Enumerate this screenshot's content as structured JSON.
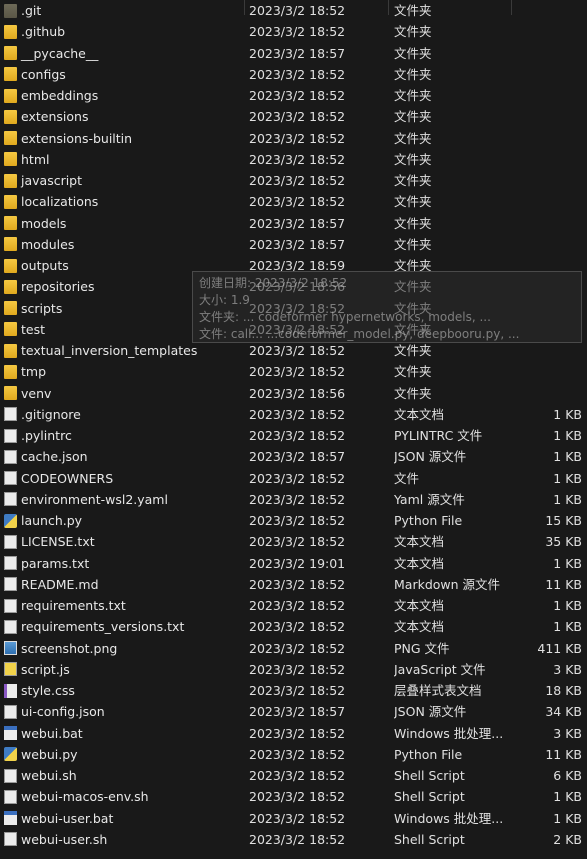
{
  "rows": [
    {
      "name": ".git",
      "date": "2023/3/2 18:52",
      "type": "文件夹",
      "size": "",
      "icon": "folder-icon-hidden"
    },
    {
      "name": ".github",
      "date": "2023/3/2 18:52",
      "type": "文件夹",
      "size": "",
      "icon": "folder-icon"
    },
    {
      "name": "__pycache__",
      "date": "2023/3/2 18:57",
      "type": "文件夹",
      "size": "",
      "icon": "folder-icon"
    },
    {
      "name": "configs",
      "date": "2023/3/2 18:52",
      "type": "文件夹",
      "size": "",
      "icon": "folder-icon"
    },
    {
      "name": "embeddings",
      "date": "2023/3/2 18:52",
      "type": "文件夹",
      "size": "",
      "icon": "folder-icon"
    },
    {
      "name": "extensions",
      "date": "2023/3/2 18:52",
      "type": "文件夹",
      "size": "",
      "icon": "folder-icon"
    },
    {
      "name": "extensions-builtin",
      "date": "2023/3/2 18:52",
      "type": "文件夹",
      "size": "",
      "icon": "folder-icon"
    },
    {
      "name": "html",
      "date": "2023/3/2 18:52",
      "type": "文件夹",
      "size": "",
      "icon": "folder-icon"
    },
    {
      "name": "javascript",
      "date": "2023/3/2 18:52",
      "type": "文件夹",
      "size": "",
      "icon": "folder-icon"
    },
    {
      "name": "localizations",
      "date": "2023/3/2 18:52",
      "type": "文件夹",
      "size": "",
      "icon": "folder-icon"
    },
    {
      "name": "models",
      "date": "2023/3/2 18:57",
      "type": "文件夹",
      "size": "",
      "icon": "folder-icon"
    },
    {
      "name": "modules",
      "date": "2023/3/2 18:57",
      "type": "文件夹",
      "size": "",
      "icon": "folder-icon"
    },
    {
      "name": "outputs",
      "date": "2023/3/2 18:59",
      "type": "文件夹",
      "size": "",
      "icon": "folder-icon"
    },
    {
      "name": "repositories",
      "date": "2023/3/2 18:56",
      "type": "文件夹",
      "size": "",
      "icon": "folder-icon"
    },
    {
      "name": "scripts",
      "date": "2023/3/2 18:52",
      "type": "文件夹",
      "size": "",
      "icon": "folder-icon"
    },
    {
      "name": "test",
      "date": "2023/3/2 18:52",
      "type": "文件夹",
      "size": "",
      "icon": "folder-icon"
    },
    {
      "name": "textual_inversion_templates",
      "date": "2023/3/2 18:52",
      "type": "文件夹",
      "size": "",
      "icon": "folder-icon"
    },
    {
      "name": "tmp",
      "date": "2023/3/2 18:52",
      "type": "文件夹",
      "size": "",
      "icon": "folder-icon"
    },
    {
      "name": "venv",
      "date": "2023/3/2 18:56",
      "type": "文件夹",
      "size": "",
      "icon": "folder-icon"
    },
    {
      "name": ".gitignore",
      "date": "2023/3/2 18:52",
      "type": "文本文档",
      "size": "1 KB",
      "icon": "file-icon"
    },
    {
      "name": ".pylintrc",
      "date": "2023/3/2 18:52",
      "type": "PYLINTRC 文件",
      "size": "1 KB",
      "icon": "file-icon"
    },
    {
      "name": "cache.json",
      "date": "2023/3/2 18:57",
      "type": "JSON 源文件",
      "size": "1 KB",
      "icon": "json-icon"
    },
    {
      "name": "CODEOWNERS",
      "date": "2023/3/2 18:52",
      "type": "文件",
      "size": "1 KB",
      "icon": "file-icon"
    },
    {
      "name": "environment-wsl2.yaml",
      "date": "2023/3/2 18:52",
      "type": "Yaml 源文件",
      "size": "1 KB",
      "icon": "yaml-icon"
    },
    {
      "name": "launch.py",
      "date": "2023/3/2 18:52",
      "type": "Python File",
      "size": "15 KB",
      "icon": "python-icon"
    },
    {
      "name": "LICENSE.txt",
      "date": "2023/3/2 18:52",
      "type": "文本文档",
      "size": "35 KB",
      "icon": "file-icon"
    },
    {
      "name": "params.txt",
      "date": "2023/3/2 19:01",
      "type": "文本文档",
      "size": "1 KB",
      "icon": "file-icon"
    },
    {
      "name": "README.md",
      "date": "2023/3/2 18:52",
      "type": "Markdown 源文件",
      "size": "11 KB",
      "icon": "markdown-icon"
    },
    {
      "name": "requirements.txt",
      "date": "2023/3/2 18:52",
      "type": "文本文档",
      "size": "1 KB",
      "icon": "file-icon"
    },
    {
      "name": "requirements_versions.txt",
      "date": "2023/3/2 18:52",
      "type": "文本文档",
      "size": "1 KB",
      "icon": "file-icon"
    },
    {
      "name": "screenshot.png",
      "date": "2023/3/2 18:52",
      "type": "PNG 文件",
      "size": "411 KB",
      "icon": "image-icon"
    },
    {
      "name": "script.js",
      "date": "2023/3/2 18:52",
      "type": "JavaScript 文件",
      "size": "3 KB",
      "icon": "javascript-icon"
    },
    {
      "name": "style.css",
      "date": "2023/3/2 18:52",
      "type": "层叠样式表文档",
      "size": "18 KB",
      "icon": "css-icon"
    },
    {
      "name": "ui-config.json",
      "date": "2023/3/2 18:57",
      "type": "JSON 源文件",
      "size": "34 KB",
      "icon": "json-icon"
    },
    {
      "name": "webui.bat",
      "date": "2023/3/2 18:52",
      "type": "Windows 批处理...",
      "size": "3 KB",
      "icon": "batch-icon"
    },
    {
      "name": "webui.py",
      "date": "2023/3/2 18:52",
      "type": "Python File",
      "size": "11 KB",
      "icon": "python-icon"
    },
    {
      "name": "webui.sh",
      "date": "2023/3/2 18:52",
      "type": "Shell Script",
      "size": "6 KB",
      "icon": "shell-icon"
    },
    {
      "name": "webui-macos-env.sh",
      "date": "2023/3/2 18:52",
      "type": "Shell Script",
      "size": "1 KB",
      "icon": "shell-icon"
    },
    {
      "name": "webui-user.bat",
      "date": "2023/3/2 18:52",
      "type": "Windows 批处理...",
      "size": "1 KB",
      "icon": "batch-icon"
    },
    {
      "name": "webui-user.sh",
      "date": "2023/3/2 18:52",
      "type": "Shell Script",
      "size": "2 KB",
      "icon": "shell-icon"
    }
  ],
  "tooltip": {
    "line1": "创建日期: 2023/3/2 18:52",
    "line2": "大小: 1.9",
    "line3": "文件夹: ...   codeformer   hypernetworks, models, ...",
    "line4": "文件: call...   ...codeformer_model.py, deepbooru.py, ..."
  },
  "colors": {
    "background": "#191919",
    "folder": "#f5c842",
    "text": "#e8e8e8"
  }
}
